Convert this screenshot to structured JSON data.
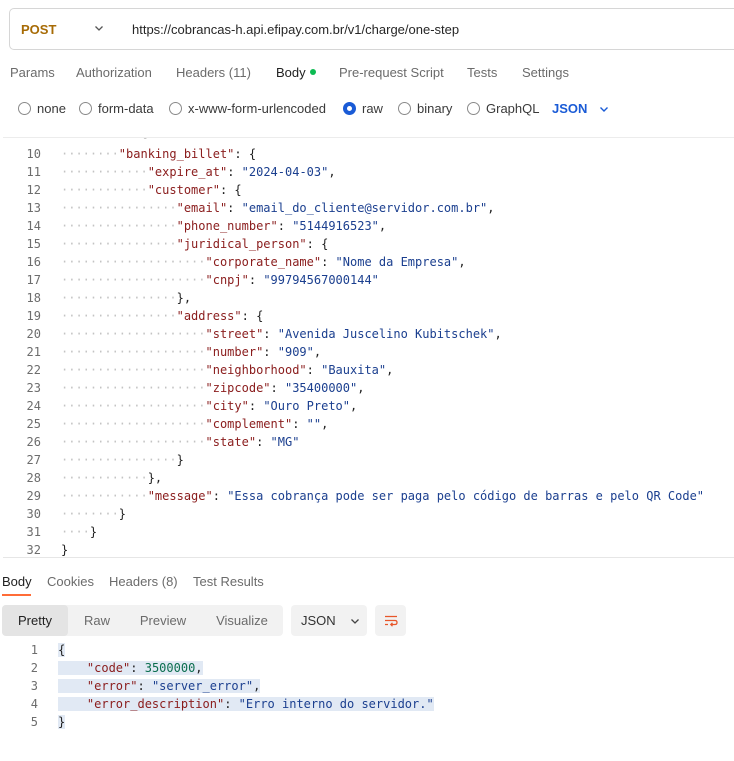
{
  "request": {
    "method": "POST",
    "url": "https://cobrancas-h.api.efipay.com.br/v1/charge/one-step"
  },
  "request_tabs": [
    "Params",
    "Authorization",
    "Headers (11)",
    "Body",
    "Pre-request Script",
    "Tests",
    "Settings"
  ],
  "body_types": [
    "none",
    "form-data",
    "x-www-form-urlencoded",
    "raw",
    "binary",
    "GraphQL"
  ],
  "body_language": "JSON",
  "editor": {
    "line_numbers": [
      "10",
      "11",
      "12",
      "13",
      "14",
      "15",
      "16",
      "17",
      "18",
      "19",
      "20",
      "21",
      "22",
      "23",
      "24",
      "25",
      "26",
      "27",
      "28",
      "29",
      "30",
      "31",
      "32"
    ],
    "lines": [
      "        \"banking_billet\": {",
      "            \"expire_at\": \"2024-04-03\",",
      "            \"customer\": {",
      "                \"email\": \"email_do_cliente@servidor.com.br\",",
      "                \"phone_number\": \"5144916523\",",
      "                \"juridical_person\": {",
      "                    \"corporate_name\": \"Nome da Empresa\",",
      "                    \"cnpj\": \"99794567000144\"",
      "                },",
      "                \"address\": {",
      "                    \"street\": \"Avenida Juscelino Kubitschek\",",
      "                    \"number\": \"909\",",
      "                    \"neighborhood\": \"Bauxita\",",
      "                    \"zipcode\": \"35400000\",",
      "                    \"city\": \"Ouro Preto\",",
      "                    \"complement\": \"\",",
      "                    \"state\": \"MG\"",
      "                }",
      "            },",
      "            \"message\": \"Essa cobrança pode ser paga pelo código de barras e pelo QR Code\"",
      "        }",
      "    }",
      "}"
    ]
  },
  "response_tabs": [
    "Body",
    "Cookies",
    "Headers (8)",
    "Test Results"
  ],
  "response_views": [
    "Pretty",
    "Raw",
    "Preview",
    "Visualize"
  ],
  "response_format": "JSON",
  "response": {
    "line_numbers": [
      "1",
      "2",
      "3",
      "4",
      "5"
    ],
    "lines": [
      "{",
      "    \"code\": 3500000,",
      "    \"error\": \"server_error\",",
      "    \"error_description\": \"Erro interno do servidor.\"",
      "}"
    ]
  },
  "colors": {
    "method": "#a76b05",
    "accent_blue": "#1a5bd6",
    "active_tab_underline": "#ff6c37",
    "status_dot": "#0cbb52"
  }
}
